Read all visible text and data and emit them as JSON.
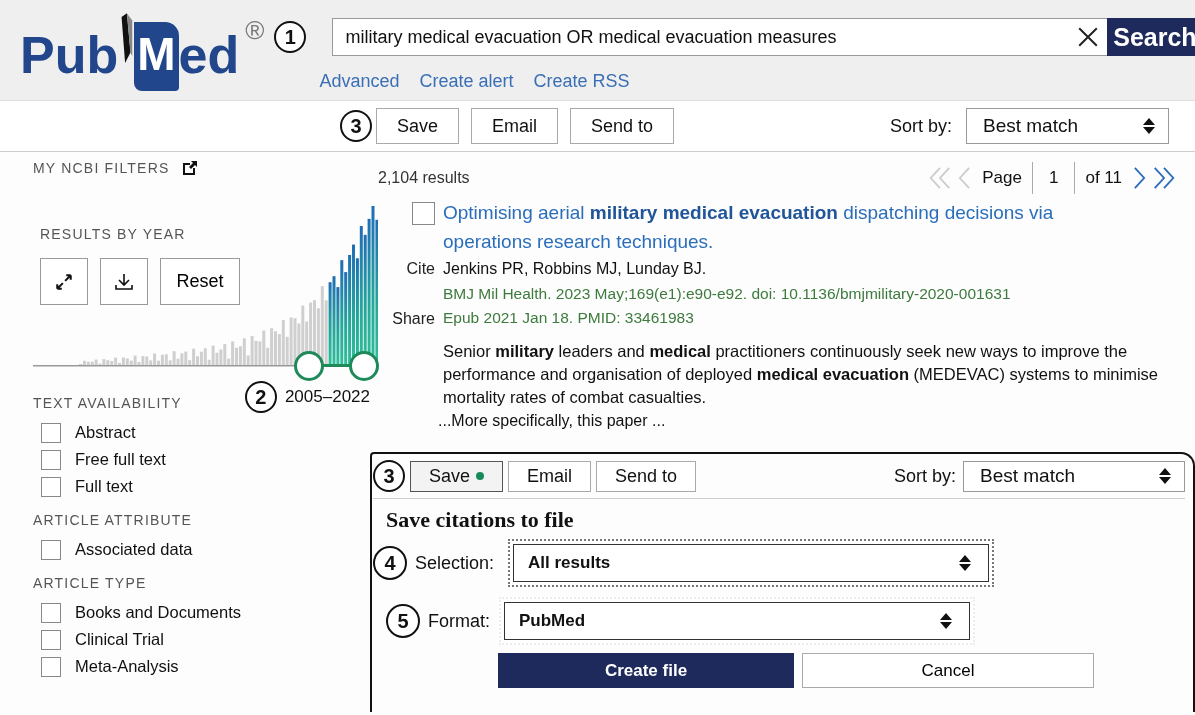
{
  "header": {
    "logo": {
      "parts": [
        "Pub",
        "M",
        "ed"
      ],
      "registered": "®"
    },
    "search": {
      "callout": "1",
      "value": "military medical evacuation OR medical evacuation measures",
      "button": "Search"
    },
    "links": [
      "Advanced",
      "Create alert",
      "Create RSS"
    ]
  },
  "toolbar": {
    "callout": "3",
    "buttons": [
      {
        "label": "Save",
        "active": false
      },
      {
        "label": "Email",
        "active": false
      },
      {
        "label": "Send to",
        "active": false
      }
    ],
    "sort_label": "Sort by:",
    "sort_value": "Best match"
  },
  "sidebar": {
    "my_filters": "MY NCBI FILTERS",
    "results_by_year": {
      "title": "RESULTS BY YEAR",
      "reset": "Reset",
      "callout": "2",
      "range": "2005–2022",
      "range_start": {
        "level": 0.8
      },
      "range_end": {
        "level": 0.96
      }
    },
    "sections": [
      {
        "title": "TEXT AVAILABILITY",
        "options": [
          {
            "label": "Abstract",
            "checked": false
          },
          {
            "label": "Free full text",
            "checked": false
          },
          {
            "label": "Full text",
            "checked": false
          }
        ]
      },
      {
        "title": "ARTICLE ATTRIBUTE",
        "options": [
          {
            "label": "Associated data",
            "checked": false
          }
        ]
      },
      {
        "title": "ARTICLE TYPE",
        "options": [
          {
            "label": "Books and Documents",
            "checked": false
          },
          {
            "label": "Clinical Trial",
            "checked": false
          },
          {
            "label": "Meta-Analysis",
            "checked": false
          }
        ]
      }
    ]
  },
  "results": {
    "count": "2,104 results",
    "pagination": {
      "page_label": "Page",
      "page": "1",
      "of": "of 11"
    },
    "articles": [
      {
        "selected": false,
        "title": "Optimising aerial **military medical evacuation** dispatching decisions via operations research techniques.",
        "cite": "Cite",
        "share": "Share",
        "authors": "Jenkins PR, Robbins MJ, Lunday BJ.",
        "citation": "BMJ Mil Health. 2023 May;169(e1):e90-e92. doi: 10.1136/bmjmilitary-2020-001631",
        "epub": "Epub 2021 Jan 18. PMID: 33461983",
        "snippet": "Senior **military** leaders and **medical** practitioners continuously seek new ways to improve the performance and organisation of deployed **medical** **evacuation** (MEDEVAC) systems to minimise mortality rates of combat casualties.",
        "more": "...More specifically, this paper ..."
      }
    ]
  },
  "save_panel": {
    "toolbar": {
      "callout": "3",
      "buttons": [
        {
          "label": "Save",
          "active": true
        },
        {
          "label": "Email",
          "active": false
        },
        {
          "label": "Send to",
          "active": false
        }
      ],
      "sort_label": "Sort by:",
      "sort_value": "Best match"
    },
    "title": "Save citations to file",
    "fields": [
      {
        "callout": "4",
        "label": "Selection:",
        "value": "All results",
        "focused": true
      },
      {
        "callout": "5",
        "label": "Format:",
        "value": "PubMed",
        "focused": false
      }
    ],
    "create": "Create file",
    "cancel": "Cancel"
  }
}
